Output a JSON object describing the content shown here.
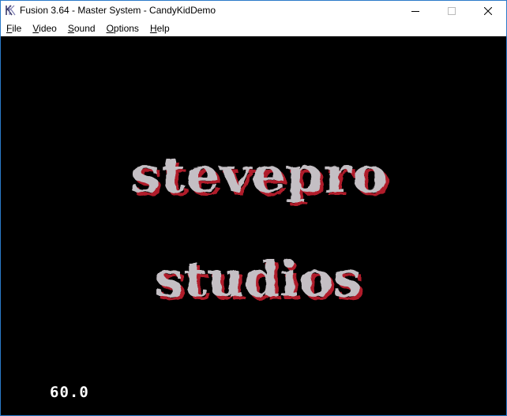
{
  "window": {
    "title": "Fusion 3.64 - Master System - CandyKidDemo",
    "app_icon": "fusion-k-icon",
    "controls": [
      "minimize-icon",
      "maximize-icon",
      "close-icon"
    ]
  },
  "menu": {
    "items": [
      {
        "label": "File",
        "accel": "F",
        "rest": "ile"
      },
      {
        "label": "Video",
        "accel": "V",
        "rest": "ideo"
      },
      {
        "label": "Sound",
        "accel": "S",
        "rest": "ound"
      },
      {
        "label": "Options",
        "accel": "O",
        "rest": "ptions"
      },
      {
        "label": "Help",
        "accel": "H",
        "rest": "elp"
      }
    ]
  },
  "screen": {
    "logo_line1": "stevepro",
    "logo_line2": "studios",
    "fps": "60.0",
    "colors": {
      "background": "#000000",
      "logo_fill": "#c4bfc4",
      "logo_shadow": "#b01c2c",
      "fps_text": "#ffffff"
    }
  }
}
